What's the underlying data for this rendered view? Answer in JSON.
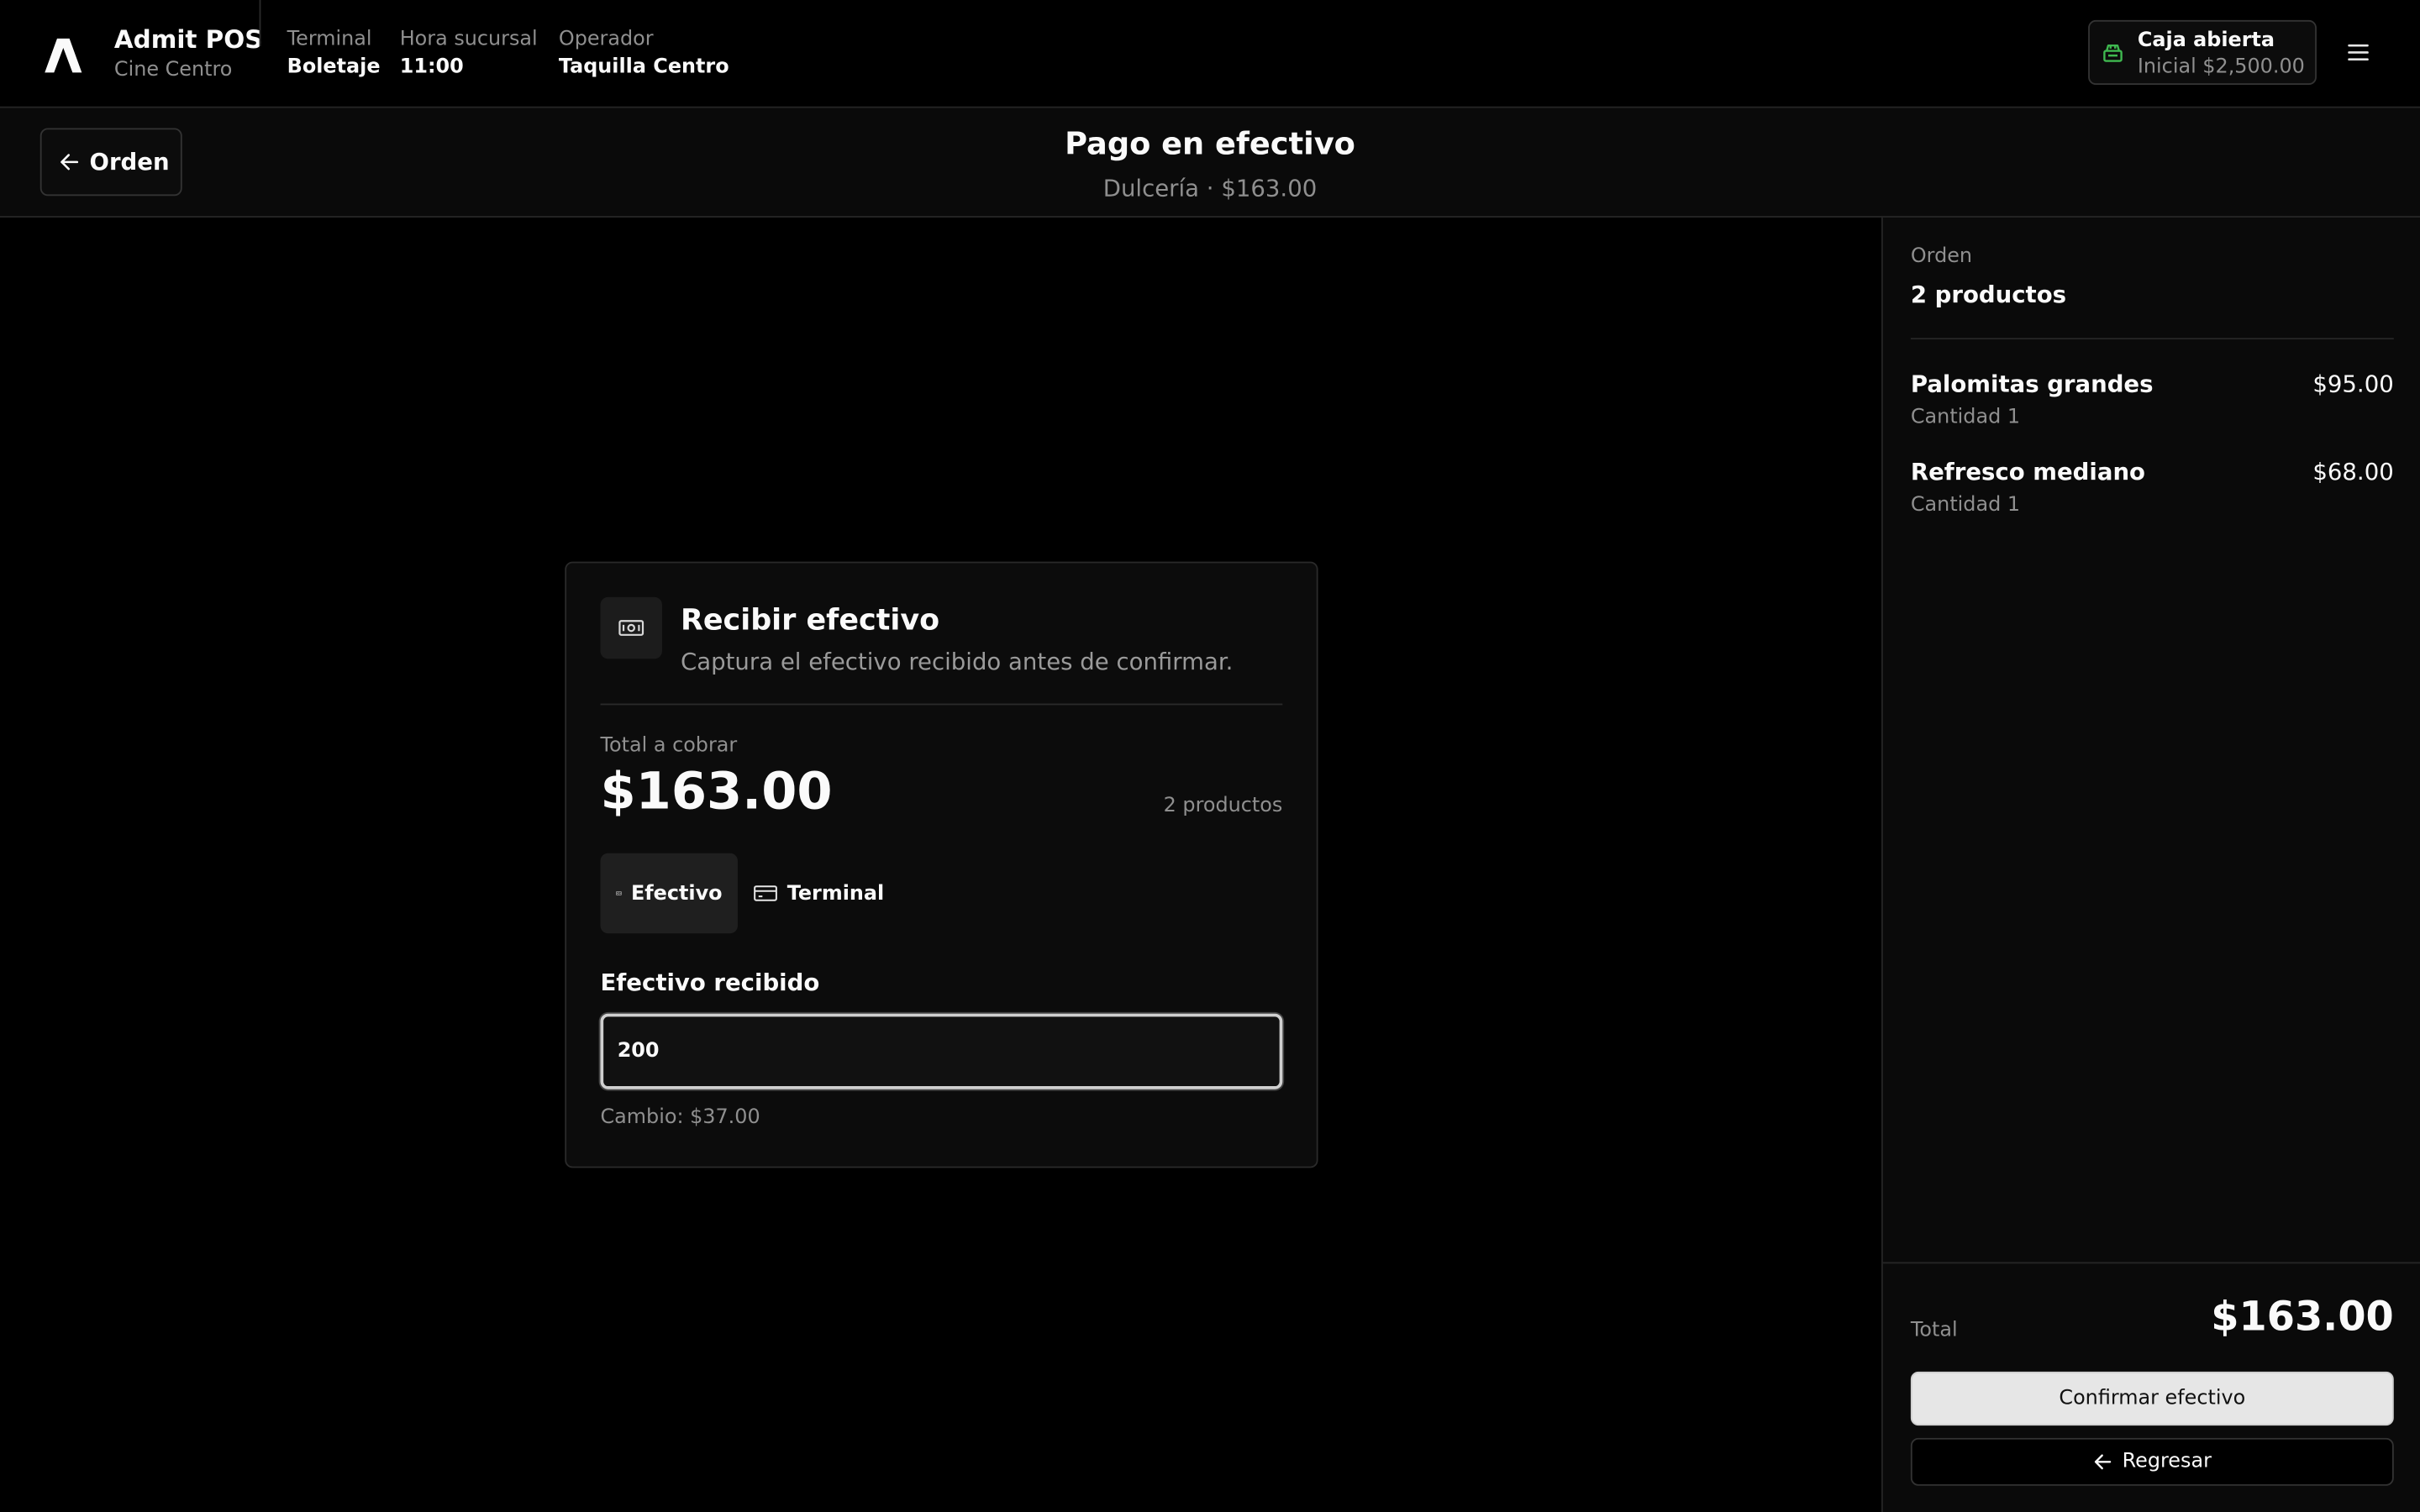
{
  "app": {
    "name": "Admit POS",
    "location": "Cine Centro"
  },
  "header": {
    "meta": [
      {
        "label": "Terminal",
        "value": "Boletaje"
      },
      {
        "label": "Hora sucursal",
        "value": "11:00"
      },
      {
        "label": "Operador",
        "value": "Taquilla Centro"
      }
    ],
    "register": {
      "title": "Caja abierta",
      "subtitle": "Inicial $2,500.00",
      "icon": "cash-register-icon",
      "icon_color": "#3fb950"
    },
    "menu_icon": "hamburger-menu-icon"
  },
  "subheader": {
    "back_label": "Orden",
    "title": "Pago en efectivo",
    "subtitle": "Dulcería · $163.00"
  },
  "payment": {
    "title": "Recibir efectivo",
    "description": "Captura el efectivo recibido antes de confirmar.",
    "total_label": "Total a cobrar",
    "total_amount": "$163.00",
    "products_count": "2 productos",
    "methods": [
      {
        "label": "Efectivo",
        "icon": "banknote-icon",
        "active": true
      },
      {
        "label": "Terminal",
        "icon": "credit-card-icon",
        "active": false
      }
    ],
    "cash_field_label": "Efectivo recibido",
    "cash_value": "200",
    "change_text": "Cambio: $37.00"
  },
  "order": {
    "label": "Orden",
    "count": "2 productos",
    "items": [
      {
        "name": "Palomitas grandes",
        "price": "$95.00",
        "quantity": "Cantidad 1"
      },
      {
        "name": "Refresco mediano",
        "price": "$68.00",
        "quantity": "Cantidad 1"
      }
    ],
    "total_label": "Total",
    "total": "$163.00",
    "confirm_label": "Confirmar efectivo",
    "return_label": "Regresar"
  }
}
